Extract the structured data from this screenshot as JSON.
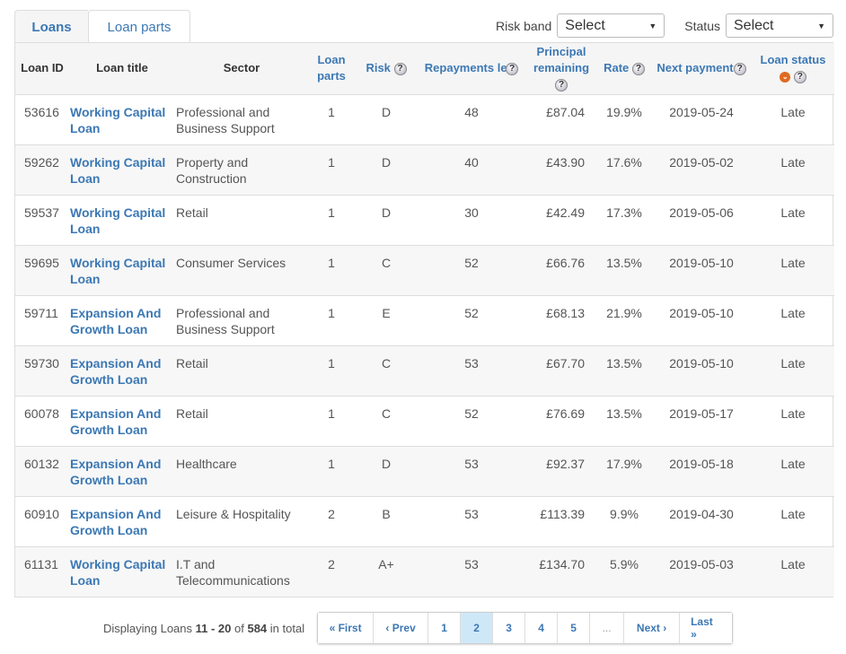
{
  "tabs": [
    {
      "label": "Loans",
      "active": true
    },
    {
      "label": "Loan parts",
      "active": false
    }
  ],
  "filters": {
    "risk_band": {
      "label": "Risk band",
      "value": "Select"
    },
    "status": {
      "label": "Status",
      "value": "Select"
    }
  },
  "table": {
    "headers": {
      "loan_id": "Loan ID",
      "loan_title": "Loan title",
      "sector": "Sector",
      "loan_parts": "Loan parts",
      "risk": "Risk",
      "repayments_left": "Repayments left",
      "principal_remaining": "Principal remaining",
      "rate": "Rate",
      "next_payment": "Next payment",
      "loan_status": "Loan status"
    },
    "help_icon": "?",
    "sort_icon": "⌄",
    "rows": [
      {
        "id": "53616",
        "title": "Working Capital Loan",
        "sector": "Professional and Business Support",
        "parts": "1",
        "risk": "D",
        "repayments": "48",
        "principal": "£87.04",
        "rate": "19.9%",
        "next": "2019-05-24",
        "status": "Late"
      },
      {
        "id": "59262",
        "title": "Working Capital Loan",
        "sector": "Property and Construction",
        "parts": "1",
        "risk": "D",
        "repayments": "40",
        "principal": "£43.90",
        "rate": "17.6%",
        "next": "2019-05-02",
        "status": "Late"
      },
      {
        "id": "59537",
        "title": "Working Capital Loan",
        "sector": "Retail",
        "parts": "1",
        "risk": "D",
        "repayments": "30",
        "principal": "£42.49",
        "rate": "17.3%",
        "next": "2019-05-06",
        "status": "Late"
      },
      {
        "id": "59695",
        "title": "Working Capital Loan",
        "sector": "Consumer Services",
        "parts": "1",
        "risk": "C",
        "repayments": "52",
        "principal": "£66.76",
        "rate": "13.5%",
        "next": "2019-05-10",
        "status": "Late"
      },
      {
        "id": "59711",
        "title": "Expansion And Growth Loan",
        "sector": "Professional and Business Support",
        "parts": "1",
        "risk": "E",
        "repayments": "52",
        "principal": "£68.13",
        "rate": "21.9%",
        "next": "2019-05-10",
        "status": "Late"
      },
      {
        "id": "59730",
        "title": "Expansion And Growth Loan",
        "sector": "Retail",
        "parts": "1",
        "risk": "C",
        "repayments": "53",
        "principal": "£67.70",
        "rate": "13.5%",
        "next": "2019-05-10",
        "status": "Late"
      },
      {
        "id": "60078",
        "title": "Expansion And Growth Loan",
        "sector": "Retail",
        "parts": "1",
        "risk": "C",
        "repayments": "52",
        "principal": "£76.69",
        "rate": "13.5%",
        "next": "2019-05-17",
        "status": "Late"
      },
      {
        "id": "60132",
        "title": "Expansion And Growth Loan",
        "sector": "Healthcare",
        "parts": "1",
        "risk": "D",
        "repayments": "53",
        "principal": "£92.37",
        "rate": "17.9%",
        "next": "2019-05-18",
        "status": "Late"
      },
      {
        "id": "60910",
        "title": "Expansion And Growth Loan",
        "sector": "Leisure & Hospitality",
        "parts": "2",
        "risk": "B",
        "repayments": "53",
        "principal": "£113.39",
        "rate": "9.9%",
        "next": "2019-04-30",
        "status": "Late"
      },
      {
        "id": "61131",
        "title": "Working Capital Loan",
        "sector": "I.T and Telecommunications",
        "parts": "2",
        "risk": "A+",
        "repayments": "53",
        "principal": "£134.70",
        "rate": "5.9%",
        "next": "2019-05-03",
        "status": "Late"
      }
    ]
  },
  "footer": {
    "prefix": "Displaying Loans ",
    "range": "11 - 20",
    "of": " of ",
    "total": "584",
    "suffix": " in total"
  },
  "pagination": {
    "first": "« First",
    "prev": "‹ Prev",
    "pages": [
      "1",
      "2",
      "3",
      "4",
      "5"
    ],
    "current": "2",
    "ellipsis": "...",
    "next": "Next ›",
    "last": "Last »"
  }
}
